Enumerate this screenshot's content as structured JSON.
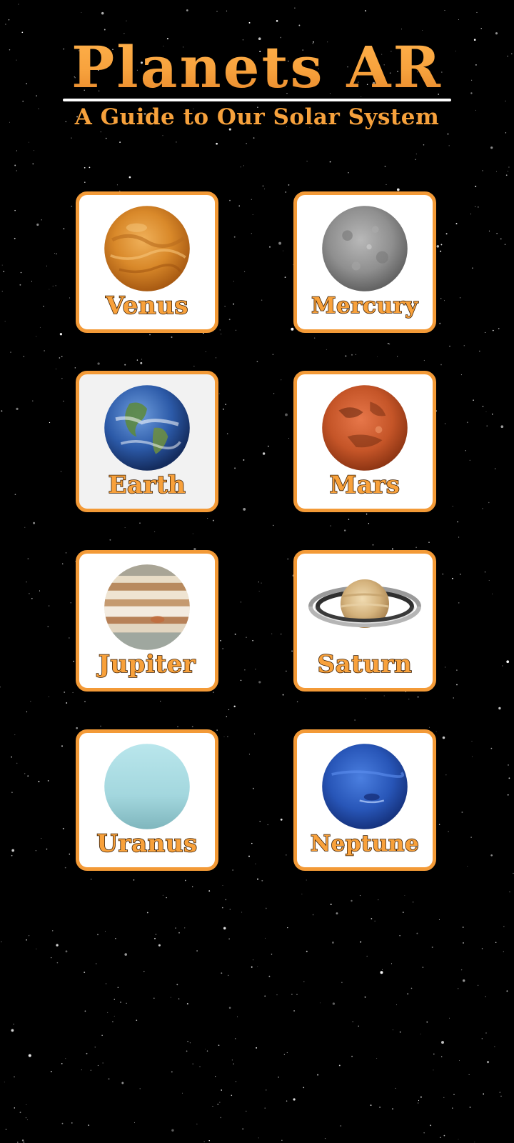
{
  "app": {
    "title": "Planets AR",
    "subtitle": "A Guide to Our Solar System"
  },
  "theme": {
    "accent": "#f39a37",
    "title_color": "#f6a13c",
    "background": "#000000",
    "card_background": "#ffffff"
  },
  "planets": [
    {
      "label": "Venus",
      "icon": "venus-icon"
    },
    {
      "label": "Mercury",
      "icon": "mercury-icon"
    },
    {
      "label": "Earth",
      "icon": "earth-icon"
    },
    {
      "label": "Mars",
      "icon": "mars-icon"
    },
    {
      "label": "Jupiter",
      "icon": "jupiter-icon"
    },
    {
      "label": "Saturn",
      "icon": "saturn-icon"
    },
    {
      "label": "Uranus",
      "icon": "uranus-icon"
    },
    {
      "label": "Neptune",
      "icon": "neptune-icon"
    }
  ]
}
